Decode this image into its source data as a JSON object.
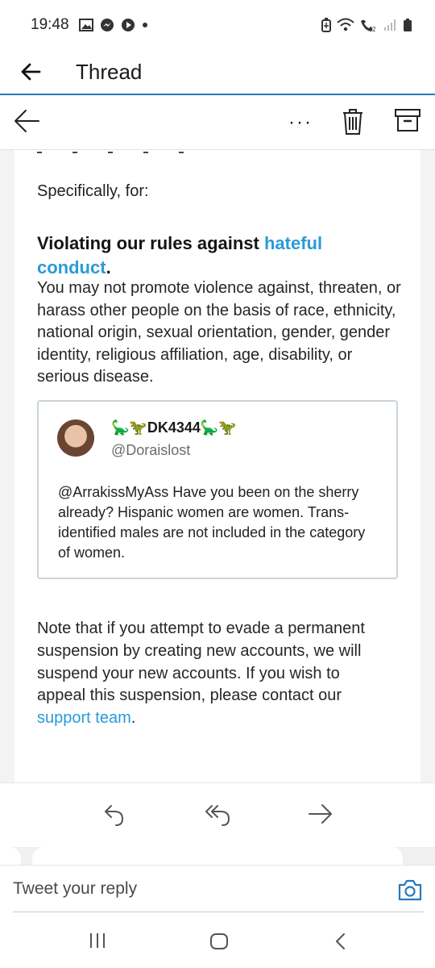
{
  "status_bar": {
    "time": "19:48",
    "left_icons": [
      "gallery-icon",
      "messenger-icon",
      "play-icon",
      "dot-icon"
    ],
    "right_icons": [
      "battery-saver-icon",
      "wifi-icon",
      "wifi-call-icon",
      "signal-icon",
      "battery-icon"
    ]
  },
  "app_bar": {
    "title": "Thread",
    "back_icon": "arrow-left-icon"
  },
  "screenshot": {
    "toolbar": {
      "more_label": "···",
      "icons": [
        "back-arrow-icon",
        "more-icon",
        "trash-icon",
        "archive-icon"
      ]
    },
    "specifically": "Specifically, for:",
    "rule_heading_prefix": "Violating our rules against ",
    "rule_heading_link": "hateful conduct",
    "rule_heading_suffix": ".",
    "rule_body": "You may not promote violence against, threaten, or harass other people on the basis of race, ethnicity, national origin, sexual orientation, gender, gender identity, religious affiliation, age, disability, or serious disease.",
    "tweet": {
      "name_emoji_left": "🦕🦖",
      "name": "DK4344",
      "name_emoji_right": "🦕🦖",
      "handle": "@Doraislost",
      "text": "@ArrakissMyAss Have you been on the sherry already? Hispanic women are women. Trans-identified males are not included in the category of women."
    },
    "note_text": "Note that if you attempt to evade a permanent suspension by creating new accounts, we will suspend your new accounts. If you wish to appeal this suspension, please contact our ",
    "note_link": "support team",
    "note_suffix": "."
  },
  "message_actions": {
    "icons": [
      "reply-icon",
      "reply-all-icon",
      "forward-icon"
    ]
  },
  "reply": {
    "placeholder": "Tweet your reply",
    "camera_icon": "camera-icon"
  },
  "system_nav": {
    "icons": [
      "recents-icon",
      "home-icon",
      "back-icon"
    ]
  },
  "colors": {
    "accent": "#2a78b8",
    "link": "#2a9ad8"
  }
}
